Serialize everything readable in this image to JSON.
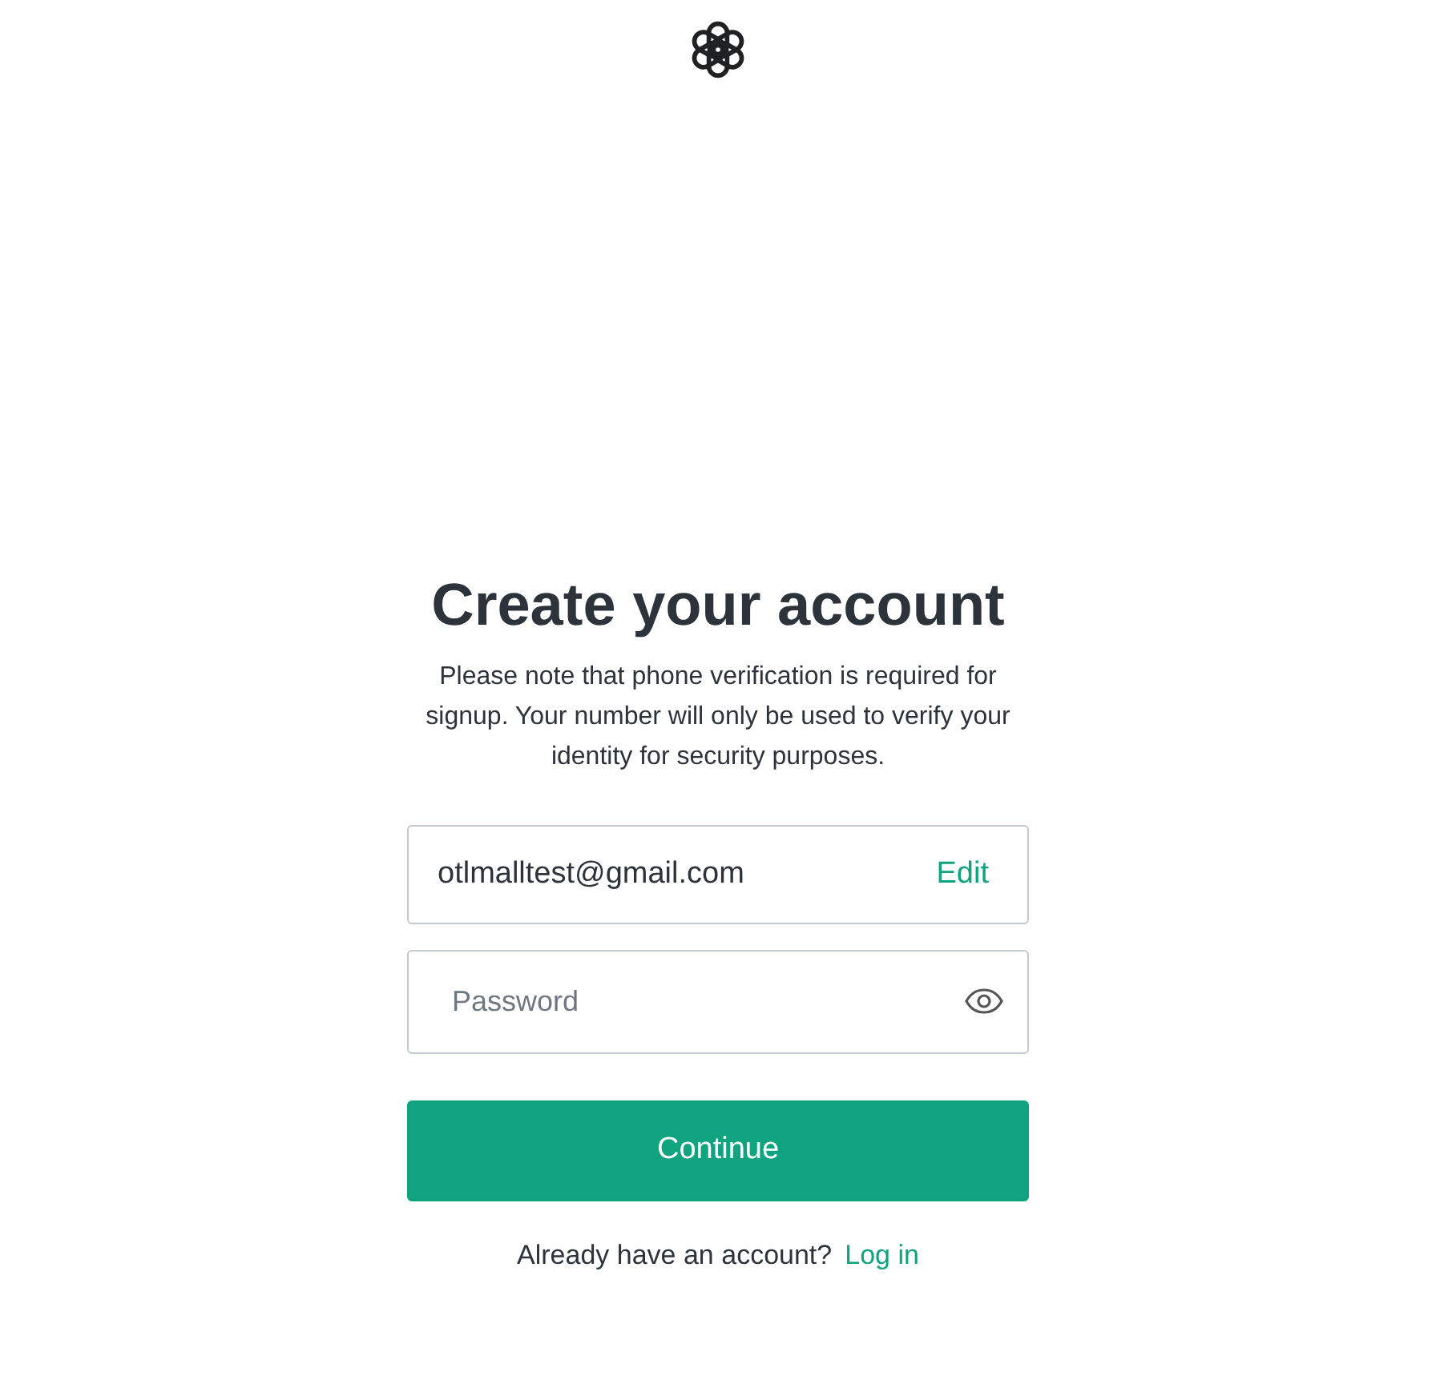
{
  "heading": "Create your account",
  "notice": "Please note that phone verification is required for signup. Your number will only be used to verify your identity for security purposes.",
  "email_field": {
    "value": "otlmalltest@gmail.com",
    "action": "Edit"
  },
  "password_field": {
    "placeholder": "Password"
  },
  "continue_button": "Continue",
  "footer": {
    "text": "Already have an account?",
    "link": "Log in"
  }
}
